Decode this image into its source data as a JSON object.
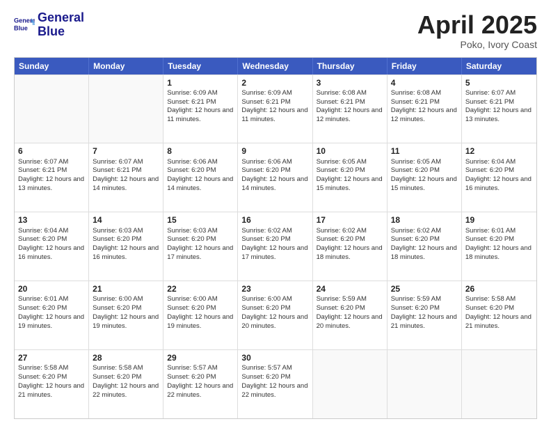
{
  "logo": {
    "line1": "General",
    "line2": "Blue"
  },
  "title": "April 2025",
  "subtitle": "Poko, Ivory Coast",
  "days": [
    "Sunday",
    "Monday",
    "Tuesday",
    "Wednesday",
    "Thursday",
    "Friday",
    "Saturday"
  ],
  "weeks": [
    [
      {
        "day": "",
        "info": ""
      },
      {
        "day": "",
        "info": ""
      },
      {
        "day": "1",
        "info": "Sunrise: 6:09 AM\nSunset: 6:21 PM\nDaylight: 12 hours and 11 minutes."
      },
      {
        "day": "2",
        "info": "Sunrise: 6:09 AM\nSunset: 6:21 PM\nDaylight: 12 hours and 11 minutes."
      },
      {
        "day": "3",
        "info": "Sunrise: 6:08 AM\nSunset: 6:21 PM\nDaylight: 12 hours and 12 minutes."
      },
      {
        "day": "4",
        "info": "Sunrise: 6:08 AM\nSunset: 6:21 PM\nDaylight: 12 hours and 12 minutes."
      },
      {
        "day": "5",
        "info": "Sunrise: 6:07 AM\nSunset: 6:21 PM\nDaylight: 12 hours and 13 minutes."
      }
    ],
    [
      {
        "day": "6",
        "info": "Sunrise: 6:07 AM\nSunset: 6:21 PM\nDaylight: 12 hours and 13 minutes."
      },
      {
        "day": "7",
        "info": "Sunrise: 6:07 AM\nSunset: 6:21 PM\nDaylight: 12 hours and 14 minutes."
      },
      {
        "day": "8",
        "info": "Sunrise: 6:06 AM\nSunset: 6:20 PM\nDaylight: 12 hours and 14 minutes."
      },
      {
        "day": "9",
        "info": "Sunrise: 6:06 AM\nSunset: 6:20 PM\nDaylight: 12 hours and 14 minutes."
      },
      {
        "day": "10",
        "info": "Sunrise: 6:05 AM\nSunset: 6:20 PM\nDaylight: 12 hours and 15 minutes."
      },
      {
        "day": "11",
        "info": "Sunrise: 6:05 AM\nSunset: 6:20 PM\nDaylight: 12 hours and 15 minutes."
      },
      {
        "day": "12",
        "info": "Sunrise: 6:04 AM\nSunset: 6:20 PM\nDaylight: 12 hours and 16 minutes."
      }
    ],
    [
      {
        "day": "13",
        "info": "Sunrise: 6:04 AM\nSunset: 6:20 PM\nDaylight: 12 hours and 16 minutes."
      },
      {
        "day": "14",
        "info": "Sunrise: 6:03 AM\nSunset: 6:20 PM\nDaylight: 12 hours and 16 minutes."
      },
      {
        "day": "15",
        "info": "Sunrise: 6:03 AM\nSunset: 6:20 PM\nDaylight: 12 hours and 17 minutes."
      },
      {
        "day": "16",
        "info": "Sunrise: 6:02 AM\nSunset: 6:20 PM\nDaylight: 12 hours and 17 minutes."
      },
      {
        "day": "17",
        "info": "Sunrise: 6:02 AM\nSunset: 6:20 PM\nDaylight: 12 hours and 18 minutes."
      },
      {
        "day": "18",
        "info": "Sunrise: 6:02 AM\nSunset: 6:20 PM\nDaylight: 12 hours and 18 minutes."
      },
      {
        "day": "19",
        "info": "Sunrise: 6:01 AM\nSunset: 6:20 PM\nDaylight: 12 hours and 18 minutes."
      }
    ],
    [
      {
        "day": "20",
        "info": "Sunrise: 6:01 AM\nSunset: 6:20 PM\nDaylight: 12 hours and 19 minutes."
      },
      {
        "day": "21",
        "info": "Sunrise: 6:00 AM\nSunset: 6:20 PM\nDaylight: 12 hours and 19 minutes."
      },
      {
        "day": "22",
        "info": "Sunrise: 6:00 AM\nSunset: 6:20 PM\nDaylight: 12 hours and 19 minutes."
      },
      {
        "day": "23",
        "info": "Sunrise: 6:00 AM\nSunset: 6:20 PM\nDaylight: 12 hours and 20 minutes."
      },
      {
        "day": "24",
        "info": "Sunrise: 5:59 AM\nSunset: 6:20 PM\nDaylight: 12 hours and 20 minutes."
      },
      {
        "day": "25",
        "info": "Sunrise: 5:59 AM\nSunset: 6:20 PM\nDaylight: 12 hours and 21 minutes."
      },
      {
        "day": "26",
        "info": "Sunrise: 5:58 AM\nSunset: 6:20 PM\nDaylight: 12 hours and 21 minutes."
      }
    ],
    [
      {
        "day": "27",
        "info": "Sunrise: 5:58 AM\nSunset: 6:20 PM\nDaylight: 12 hours and 21 minutes."
      },
      {
        "day": "28",
        "info": "Sunrise: 5:58 AM\nSunset: 6:20 PM\nDaylight: 12 hours and 22 minutes."
      },
      {
        "day": "29",
        "info": "Sunrise: 5:57 AM\nSunset: 6:20 PM\nDaylight: 12 hours and 22 minutes."
      },
      {
        "day": "30",
        "info": "Sunrise: 5:57 AM\nSunset: 6:20 PM\nDaylight: 12 hours and 22 minutes."
      },
      {
        "day": "",
        "info": ""
      },
      {
        "day": "",
        "info": ""
      },
      {
        "day": "",
        "info": ""
      }
    ]
  ]
}
